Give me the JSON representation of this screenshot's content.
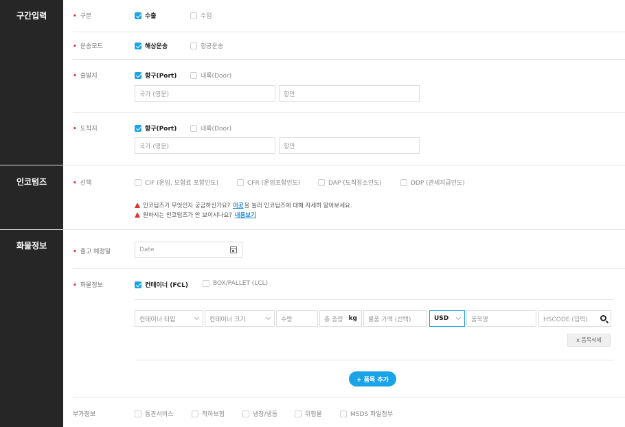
{
  "sections": {
    "route": "구간입력",
    "incoterms": "인코텀즈",
    "cargo": "화물정보"
  },
  "route": {
    "type": {
      "label": "구분",
      "options": [
        {
          "label": "수출",
          "checked": true
        },
        {
          "label": "수입",
          "checked": false
        }
      ]
    },
    "mode": {
      "label": "운송모드",
      "options": [
        {
          "label": "해상운송",
          "checked": true
        },
        {
          "label": "항공운송",
          "checked": false
        }
      ]
    },
    "origin": {
      "label": "출발지",
      "options": [
        {
          "label": "항구(Port)",
          "checked": true
        },
        {
          "label": "내륙(Door)",
          "checked": false
        }
      ],
      "country_placeholder": "국가 (영문)",
      "port_placeholder": "항만"
    },
    "destination": {
      "label": "도착지",
      "options": [
        {
          "label": "항구(Port)",
          "checked": true
        },
        {
          "label": "내륙(Door)",
          "checked": false
        }
      ],
      "country_placeholder": "국가 (영문)",
      "port_placeholder": "항만"
    }
  },
  "incoterms": {
    "label": "선택",
    "options": [
      {
        "label": "CIF (운임, 보험료 포함인도)",
        "checked": false
      },
      {
        "label": "CFR (운임포함인도)",
        "checked": false
      },
      {
        "label": "DAP (도착장소인도)",
        "checked": false
      },
      {
        "label": "DDP (관세지급인도)",
        "checked": false
      }
    ],
    "notice1_pre": "인코텀즈가 무엇인지 궁금하신가요?",
    "notice1_link": "이곳",
    "notice1_post": "을 눌러 인코텀즈에 대해 자세히 알아보세요.",
    "notice2_pre": "원하시는 인코텀즈가 안 보이시나요?",
    "notice2_link": "내용보기"
  },
  "cargo": {
    "ship_date": {
      "label": "출고 예정일",
      "placeholder": "Date"
    },
    "info": {
      "label": "화물정보",
      "options": [
        {
          "label": "컨테이너 (FCL)",
          "checked": true
        },
        {
          "label": "BOX/PALLET (LCL)",
          "checked": false
        }
      ]
    },
    "row": {
      "container_type": "컨테이너 타입",
      "container_size": "컨테이너 크기",
      "quantity": "수량",
      "total_weight": "총 중량",
      "weight_unit": "kg",
      "item_value": "물품 가액 (선택)",
      "currency": "USD",
      "item_name": "품목명",
      "hscode": "HSCODE (입력)"
    },
    "delete_button": "x 품목삭제",
    "add_button": "+ 품목 추가",
    "extra": {
      "label": "부가정보",
      "options": [
        {
          "label": "통관서비스",
          "checked": false
        },
        {
          "label": "적하보험",
          "checked": false
        },
        {
          "label": "냉장/냉동",
          "checked": false
        },
        {
          "label": "위험물",
          "checked": false
        },
        {
          "label": "MSDS 파일첨부",
          "checked": false
        }
      ]
    }
  },
  "colors": {
    "sidebar": "#262626",
    "accent": "#1aa3e6",
    "required": "#e0302a",
    "link": "#1a88d8"
  },
  "icons": {
    "checkbox_checked": "check-icon",
    "date": "calendar-icon",
    "search": "search-icon",
    "warning": "warning-icon",
    "select": "chevron-down-icon"
  }
}
